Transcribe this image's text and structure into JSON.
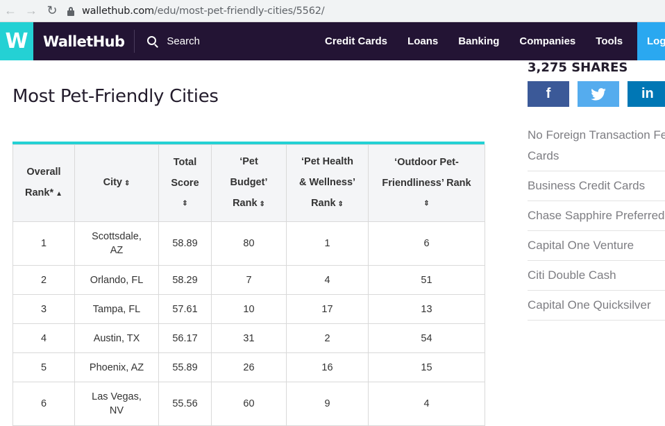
{
  "browser": {
    "back_icon": "arrow-left-icon",
    "forward_icon": "arrow-right-icon",
    "reload_icon": "reload-icon",
    "url_host": "wallethub.com",
    "url_path": "/edu/most-pet-friendly-cities/5562/"
  },
  "header": {
    "logo_letter": "W",
    "logo_text": "WalletHub",
    "search_label": "Search",
    "nav": [
      "Credit Cards",
      "Loans",
      "Banking",
      "Companies",
      "Tools"
    ],
    "login_label": "Log",
    "brand_color": "#231434",
    "accent_color": "#24d1d4"
  },
  "main": {
    "title": "Most Pet-Friendly Cities",
    "table": {
      "headers": {
        "rank": [
          "Overall",
          "Rank*"
        ],
        "city": "City",
        "score": [
          "Total",
          "Score"
        ],
        "budget": [
          "‘Pet",
          "Budget’",
          "Rank"
        ],
        "health": [
          "‘Pet Health",
          "& Wellness’",
          "Rank"
        ],
        "outdoor": [
          "‘Outdoor Pet-",
          "Friendliness’ Rank"
        ]
      },
      "rows": [
        {
          "rank": "1",
          "city": [
            "Scottsdale,",
            "AZ"
          ],
          "score": "58.89",
          "budget": "80",
          "health": "1",
          "outdoor": "6"
        },
        {
          "rank": "2",
          "city": [
            "Orlando, FL"
          ],
          "score": "58.29",
          "budget": "7",
          "health": "4",
          "outdoor": "51"
        },
        {
          "rank": "3",
          "city": [
            "Tampa, FL"
          ],
          "score": "57.61",
          "budget": "10",
          "health": "17",
          "outdoor": "13"
        },
        {
          "rank": "4",
          "city": [
            "Austin, TX"
          ],
          "score": "56.17",
          "budget": "31",
          "health": "2",
          "outdoor": "54"
        },
        {
          "rank": "5",
          "city": [
            "Phoenix, AZ"
          ],
          "score": "55.89",
          "budget": "26",
          "health": "16",
          "outdoor": "15"
        },
        {
          "rank": "6",
          "city": [
            "Las Vegas,",
            "NV"
          ],
          "score": "55.56",
          "budget": "60",
          "health": "9",
          "outdoor": "4"
        }
      ]
    }
  },
  "sidebar": {
    "shares": "3,275 SHARES",
    "share_buttons": [
      {
        "name": "facebook",
        "glyph": "f",
        "color": "#3b5998"
      },
      {
        "name": "twitter",
        "glyph": "🐦",
        "color": "#55acee"
      },
      {
        "name": "linkedin",
        "glyph": "in",
        "color": "#0077b5"
      }
    ],
    "links": [
      "No Foreign Transaction Fee Cards",
      "Business Credit Cards",
      "Chase Sapphire Preferred",
      "Capital One Venture",
      "Citi Double Cash",
      "Capital One Quicksilver"
    ]
  }
}
